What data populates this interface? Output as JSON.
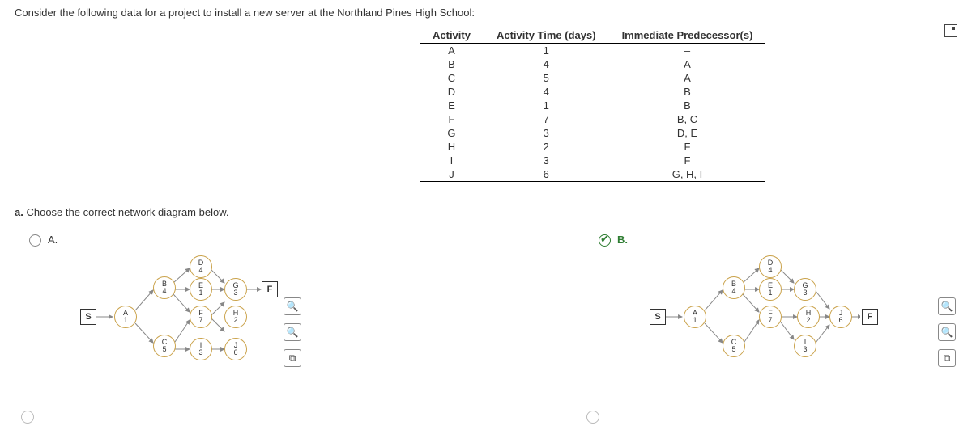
{
  "prompt": "Consider the following data for a project to install a new server at the Northland Pines High School:",
  "table": {
    "headers": [
      "Activity",
      "Activity Time (days)",
      "Immediate Predecessor(s)"
    ],
    "rows": [
      {
        "a": "A",
        "t": "1",
        "p": "–"
      },
      {
        "a": "B",
        "t": "4",
        "p": "A"
      },
      {
        "a": "C",
        "t": "5",
        "p": "A"
      },
      {
        "a": "D",
        "t": "4",
        "p": "B"
      },
      {
        "a": "E",
        "t": "1",
        "p": "B"
      },
      {
        "a": "F",
        "t": "7",
        "p": "B, C"
      },
      {
        "a": "G",
        "t": "3",
        "p": "D, E"
      },
      {
        "a": "H",
        "t": "2",
        "p": "F"
      },
      {
        "a": "I",
        "t": "3",
        "p": "F"
      },
      {
        "a": "J",
        "t": "6",
        "p": "G, H, I"
      }
    ]
  },
  "part_a": {
    "label": "a.",
    "text": "Choose the correct network diagram below."
  },
  "options": {
    "A": "A.",
    "B": "B."
  },
  "nodes": {
    "S": "S",
    "F": "F",
    "A": {
      "l": "A",
      "v": "1"
    },
    "B": {
      "l": "B",
      "v": "4"
    },
    "C": {
      "l": "C",
      "v": "5"
    },
    "D": {
      "l": "D",
      "v": "4"
    },
    "E": {
      "l": "E",
      "v": "1"
    },
    "Ff": {
      "l": "F",
      "v": "7"
    },
    "G": {
      "l": "G",
      "v": "3"
    },
    "H": {
      "l": "H",
      "v": "2"
    },
    "I": {
      "l": "I",
      "v": "3"
    },
    "J": {
      "l": "J",
      "v": "6"
    }
  },
  "tools": {
    "zoom_in": "zoom-in-icon",
    "zoom_out": "zoom-out-icon",
    "popout": "popout-icon"
  }
}
